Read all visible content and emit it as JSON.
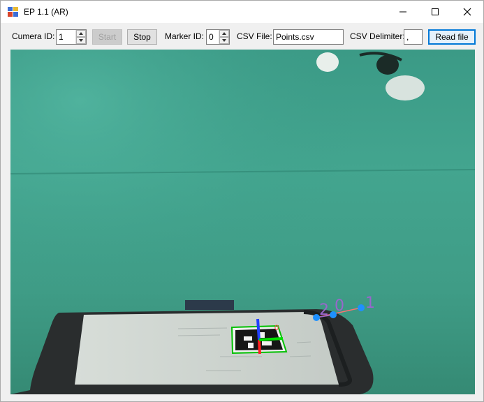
{
  "window": {
    "title": "EP 1.1 (AR)"
  },
  "toolbar": {
    "camera_id_label": "Cumera ID:",
    "camera_id_value": "1",
    "start_label": "Start",
    "stop_label": "Stop",
    "marker_id_label": "Marker ID:",
    "marker_id_value": "0",
    "csv_file_label": "CSV File:",
    "csv_file_value": "Points.csv",
    "csv_delimiter_label": "CSV Delimiter:",
    "csv_delimiter_value": ",",
    "read_file_label": "Read file"
  },
  "overlay": {
    "point_labels": [
      "2",
      "0",
      "1"
    ],
    "colors": {
      "points": "#1e90ff",
      "labels": "#9966cc",
      "marker_outline": "#00c000",
      "axis_x": "#ff2020",
      "axis_y": "#00e000",
      "axis_z": "#2040ff"
    }
  },
  "icons": {
    "app": "app-icon",
    "minimize": "minimize-icon",
    "maximize": "maximize-icon",
    "close": "close-icon"
  }
}
